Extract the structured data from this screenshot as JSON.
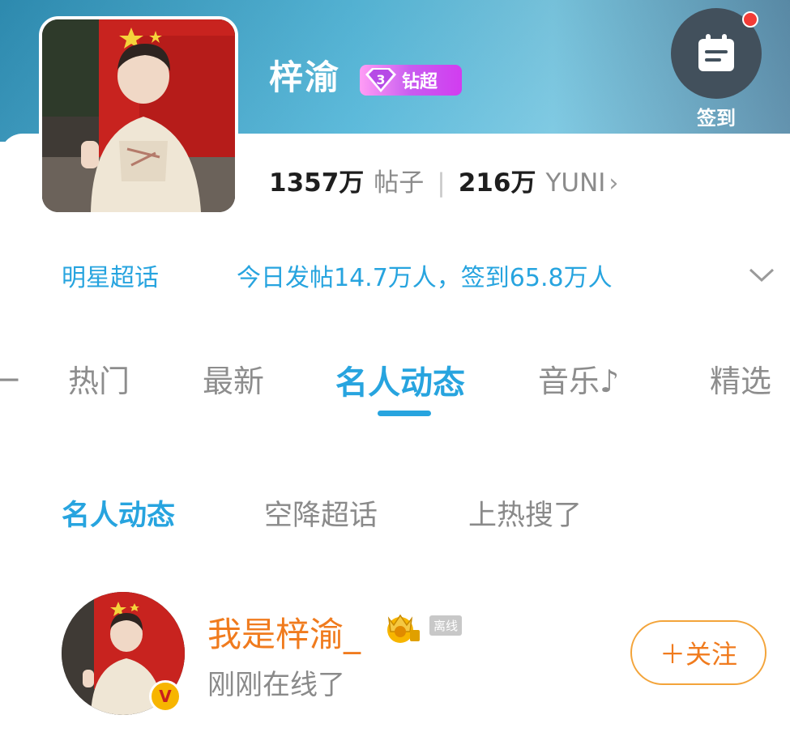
{
  "header": {
    "title": "梓渝",
    "badge_level": "3",
    "badge_label": "钻超",
    "checkin_label": "签到",
    "icon": "calendar-icon"
  },
  "stats": {
    "posts_num": "1357万",
    "posts_unit": "帖子",
    "fans_num": "216万",
    "fans_unit": "YUNI",
    "chevron": "›"
  },
  "info": {
    "category": "明星超话",
    "detail": "今日发帖14.7万人，签到65.8万人",
    "expand_icon": "chevron-down-icon"
  },
  "tabs": [
    "热门",
    "最新",
    "名人动态",
    "音乐♪",
    "精选"
  ],
  "active_tab": "名人动态",
  "subtabs": [
    "名人动态",
    "空降超话",
    "上热搜了"
  ],
  "post": {
    "name": "我是梓渝_",
    "offline": "离线",
    "status": "刚刚在线了",
    "follow_label": "＋关注",
    "verified": "V"
  },
  "watermark": "",
  "colors": {
    "accent": "#27a4df",
    "orange": "#f07b1e",
    "badge_pink": "#d23cf0",
    "notify_red": "#f23b36"
  }
}
